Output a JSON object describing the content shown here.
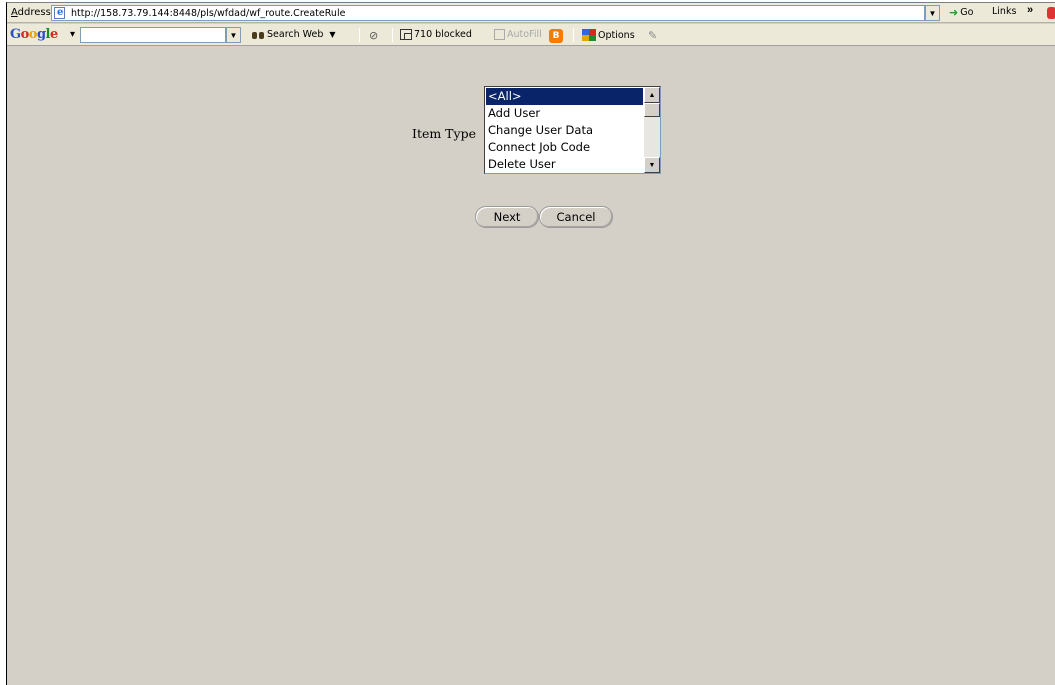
{
  "browser": {
    "address_label_prefix": "A",
    "address_label_rest": "ddress",
    "url": "http://158.73.79.144:8448/pls/wfdad/wf_route.CreateRule",
    "go_label": "Go",
    "links_label": "Links",
    "chevron": "»"
  },
  "google_toolbar": {
    "logo_letters": [
      "G",
      "o",
      "o",
      "g",
      "l",
      "e"
    ],
    "logo_arrow": "▾",
    "search_value": "",
    "search_web_label": "Search Web",
    "blocked_label": "710 blocked",
    "autofill_label": "AutoFill",
    "options_label": "Options"
  },
  "form": {
    "item_type_label": "Item Type",
    "item_type_options": [
      "<All>",
      "Add User",
      "Change User Data",
      "Connect Job Code",
      "Delete User"
    ],
    "selected_option": "<All>",
    "next_label": "Next",
    "cancel_label": "Cancel"
  },
  "colors": {
    "page_background": "#d4d0c8",
    "selection_background": "#0a246a"
  }
}
